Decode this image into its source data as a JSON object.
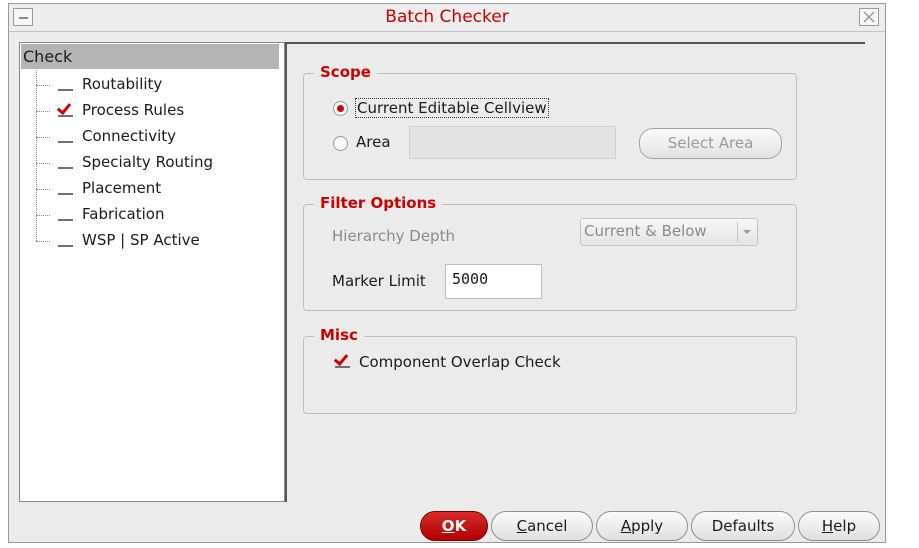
{
  "window": {
    "title": "Batch Checker"
  },
  "tree": {
    "root": "Check",
    "items": [
      {
        "label": "Routability",
        "checked": false
      },
      {
        "label": "Process Rules",
        "checked": true
      },
      {
        "label": "Connectivity",
        "checked": false
      },
      {
        "label": "Specialty Routing",
        "checked": false
      },
      {
        "label": "Placement",
        "checked": false
      },
      {
        "label": "Fabrication",
        "checked": false
      },
      {
        "label": "WSP | SP Active",
        "checked": false
      }
    ]
  },
  "scope": {
    "title": "Scope",
    "current_label": "Current Editable Cellview",
    "area_label": "Area",
    "area_value": "",
    "select_area_label": "Select Area",
    "selected": "current"
  },
  "filter": {
    "title": "Filter Options",
    "hierarchy_label": "Hierarchy Depth",
    "hierarchy_value": "Current & Below",
    "marker_label": "Marker Limit",
    "marker_value": "5000"
  },
  "misc": {
    "title": "Misc",
    "overlap_label": "Component Overlap Check",
    "overlap_checked": true
  },
  "buttons": {
    "ok_first": "O",
    "ok_rest": "K",
    "cancel_first": "C",
    "cancel_rest": "ancel",
    "apply_first": "A",
    "apply_rest": "pply",
    "defaults": "Defaults",
    "help_first": "H",
    "help_rest": "elp"
  },
  "colors": {
    "accent": "#cc0000",
    "check": "#d40000"
  }
}
